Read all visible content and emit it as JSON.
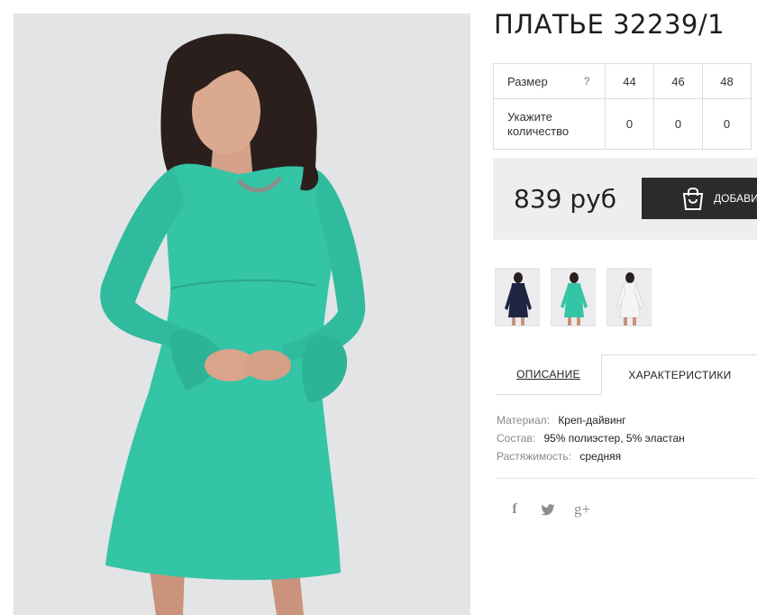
{
  "product": {
    "title": "ПЛАТЬЕ 32239/1",
    "sizes": {
      "size_label": "Размер",
      "help": "?",
      "qty_label": "Укажите количество",
      "columns": [
        {
          "size": "44",
          "qty": "0"
        },
        {
          "size": "46",
          "qty": "0"
        },
        {
          "size": "48",
          "qty": "0"
        }
      ]
    },
    "price": "839 руб",
    "add_button_label": "ДОБАВИ",
    "thumbnails": [
      "navy",
      "turquoise",
      "white"
    ]
  },
  "tabs": [
    {
      "label": "ОПИСАНИЕ",
      "active": false
    },
    {
      "label": "ХАРАКТЕРИСТИКИ",
      "active": true
    }
  ],
  "specs": [
    {
      "key": "Материал:",
      "value": "Креп-дайвинг"
    },
    {
      "key": "Состав:",
      "value": "95% полиэстер, 5% эластан"
    },
    {
      "key": "Растяжимость:",
      "value": "средняя"
    }
  ],
  "share": {
    "facebook": "f",
    "twitter": "twitter-icon",
    "googleplus": "g+"
  },
  "colors": {
    "dress": "#34c4a6",
    "hair": "#2a1f1c",
    "skin": "#d9a48b",
    "button": "#2b2b2b",
    "price_bg": "#eeeeee"
  }
}
